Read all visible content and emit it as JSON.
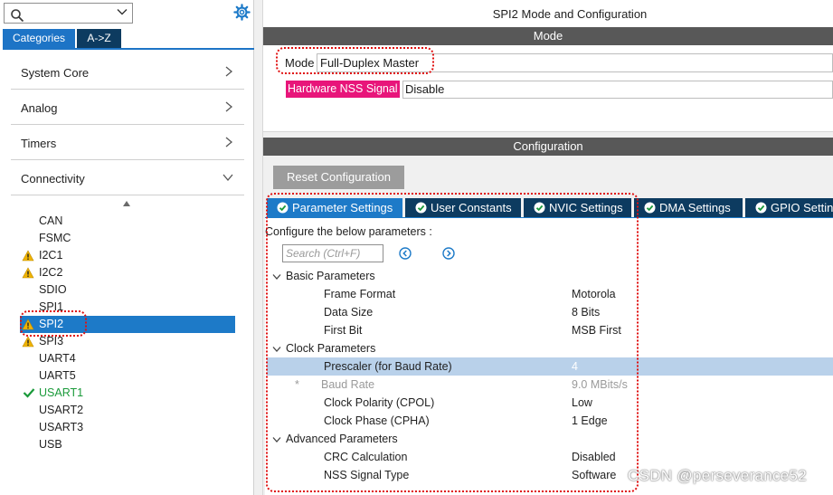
{
  "left": {
    "tabs": {
      "categories": "Categories",
      "atoz": "A->Z"
    },
    "categories": [
      {
        "label": "System Core",
        "expanded": false
      },
      {
        "label": "Analog",
        "expanded": false
      },
      {
        "label": "Timers",
        "expanded": false
      },
      {
        "label": "Connectivity",
        "expanded": true
      }
    ],
    "peripherals": [
      {
        "name": "CAN",
        "status": "none"
      },
      {
        "name": "FSMC",
        "status": "none"
      },
      {
        "name": "I2C1",
        "status": "warning"
      },
      {
        "name": "I2C2",
        "status": "warning"
      },
      {
        "name": "SDIO",
        "status": "none"
      },
      {
        "name": "SPI1",
        "status": "none"
      },
      {
        "name": "SPI2",
        "status": "warning-selected"
      },
      {
        "name": "SPI3",
        "status": "warning"
      },
      {
        "name": "UART4",
        "status": "none"
      },
      {
        "name": "UART5",
        "status": "none"
      },
      {
        "name": "USART1",
        "status": "ok"
      },
      {
        "name": "USART2",
        "status": "none"
      },
      {
        "name": "USART3",
        "status": "none"
      },
      {
        "name": "USB",
        "status": "none"
      }
    ]
  },
  "right": {
    "title": "SPI2 Mode and Configuration",
    "mode_section": "Mode",
    "mode_label": "Mode",
    "mode_value": "Full-Duplex Master",
    "nss_label": "Hardware NSS Signal",
    "nss_value": "Disable",
    "config_section": "Configuration",
    "reset_button": "Reset Configuration",
    "tabs": [
      "Parameter Settings",
      "User Constants",
      "NVIC Settings",
      "DMA Settings",
      "GPIO Settings"
    ],
    "configure_note": "Configure the below parameters :",
    "search_placeholder": "Search (Ctrl+F)",
    "groups": [
      {
        "name": "Basic Parameters",
        "params": [
          {
            "key": "Frame Format",
            "value": "Motorola"
          },
          {
            "key": "Data Size",
            "value": "8 Bits"
          },
          {
            "key": "First Bit",
            "value": "MSB First"
          }
        ]
      },
      {
        "name": "Clock Parameters",
        "params": [
          {
            "key": "Prescaler (for Baud Rate)",
            "value": "4"
          },
          {
            "key": "Baud Rate",
            "value": "9.0 MBits/s"
          },
          {
            "key": "Clock Polarity (CPOL)",
            "value": "Low"
          },
          {
            "key": "Clock Phase (CPHA)",
            "value": "1 Edge"
          }
        ]
      },
      {
        "name": "Advanced Parameters",
        "params": [
          {
            "key": "CRC Calculation",
            "value": "Disabled"
          },
          {
            "key": "NSS Signal Type",
            "value": "Software"
          }
        ]
      }
    ]
  },
  "colors": {
    "accent": "#1d7ac8",
    "tab_dark": "#0d3b60",
    "section_bar": "#585858",
    "nss_highlight": "#e8157a",
    "annotation": "#e01010",
    "ok_green": "#1a9a3a",
    "warning": "#f0b400"
  },
  "icons": {
    "search": "search-icon",
    "gear": "gear-icon",
    "chevron": "chevron-right-icon",
    "warning": "warning-icon",
    "check": "check-icon",
    "tab_ok": "check-circle-icon",
    "nav_prev": "arrow-left-circle-icon",
    "nav_next": "arrow-right-circle-icon"
  },
  "watermark": "CSDN @perseverance52"
}
